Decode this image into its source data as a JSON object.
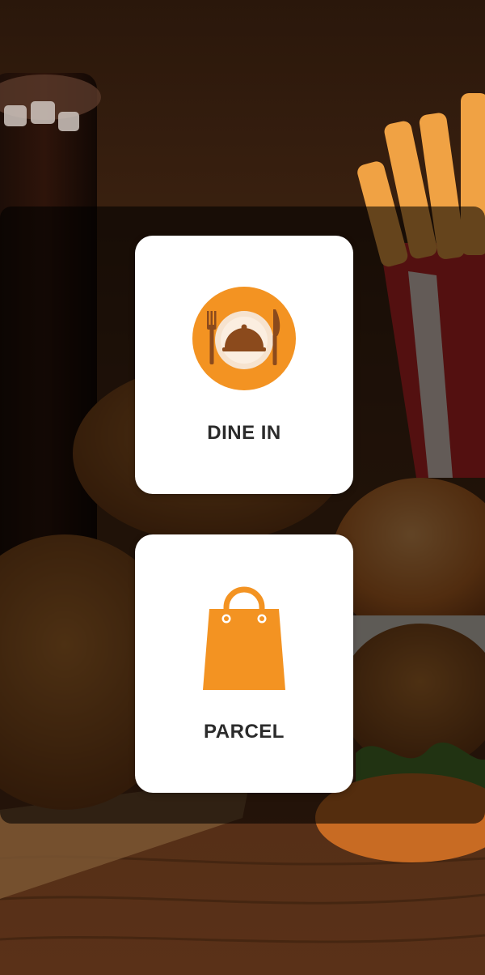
{
  "options": {
    "dine_in": {
      "label": "DINE IN",
      "icon": "dine-in-plate-cutlery-icon"
    },
    "parcel": {
      "label": "PARCEL",
      "icon": "shopping-bag-icon"
    }
  },
  "colors": {
    "accent_orange": "#F39322",
    "icon_brown": "#8B4A1C",
    "card_background": "#FFFFFF",
    "label_text": "#2B2B2B",
    "overlay": "rgba(0,0,0,0.58)"
  }
}
